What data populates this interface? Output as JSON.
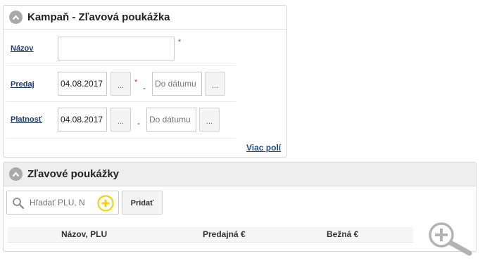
{
  "campaign": {
    "title": "Kampaň - Zľavová poukážka",
    "name_label": "Názov",
    "name_value": "",
    "sale_label": "Predaj",
    "sale_from": "04.08.2017",
    "sale_to_placeholder": "Do dátumu",
    "validity_label": "Platnosť",
    "validity_from": "04.08.2017",
    "validity_to_placeholder": "Do dátumu",
    "dots": "...",
    "required_mark": "*",
    "range_dash": "-",
    "more_fields": "Viac polí"
  },
  "vouchers": {
    "title": "Zľavové poukážky",
    "search_placeholder": "Hľadať PLU, N",
    "add_label": "Pridať",
    "columns": [
      "Názov, PLU",
      "Predajná €",
      "Bežná €"
    ]
  },
  "colors": {
    "accent_yellow": "#f2d21a",
    "link_blue": "#1d4d86",
    "required_red": "#d03030"
  },
  "icons": {
    "collapse": "chevron-up-icon",
    "search": "search-icon",
    "add": "plus-circle-icon",
    "zoom": "zoom-in-icon"
  }
}
